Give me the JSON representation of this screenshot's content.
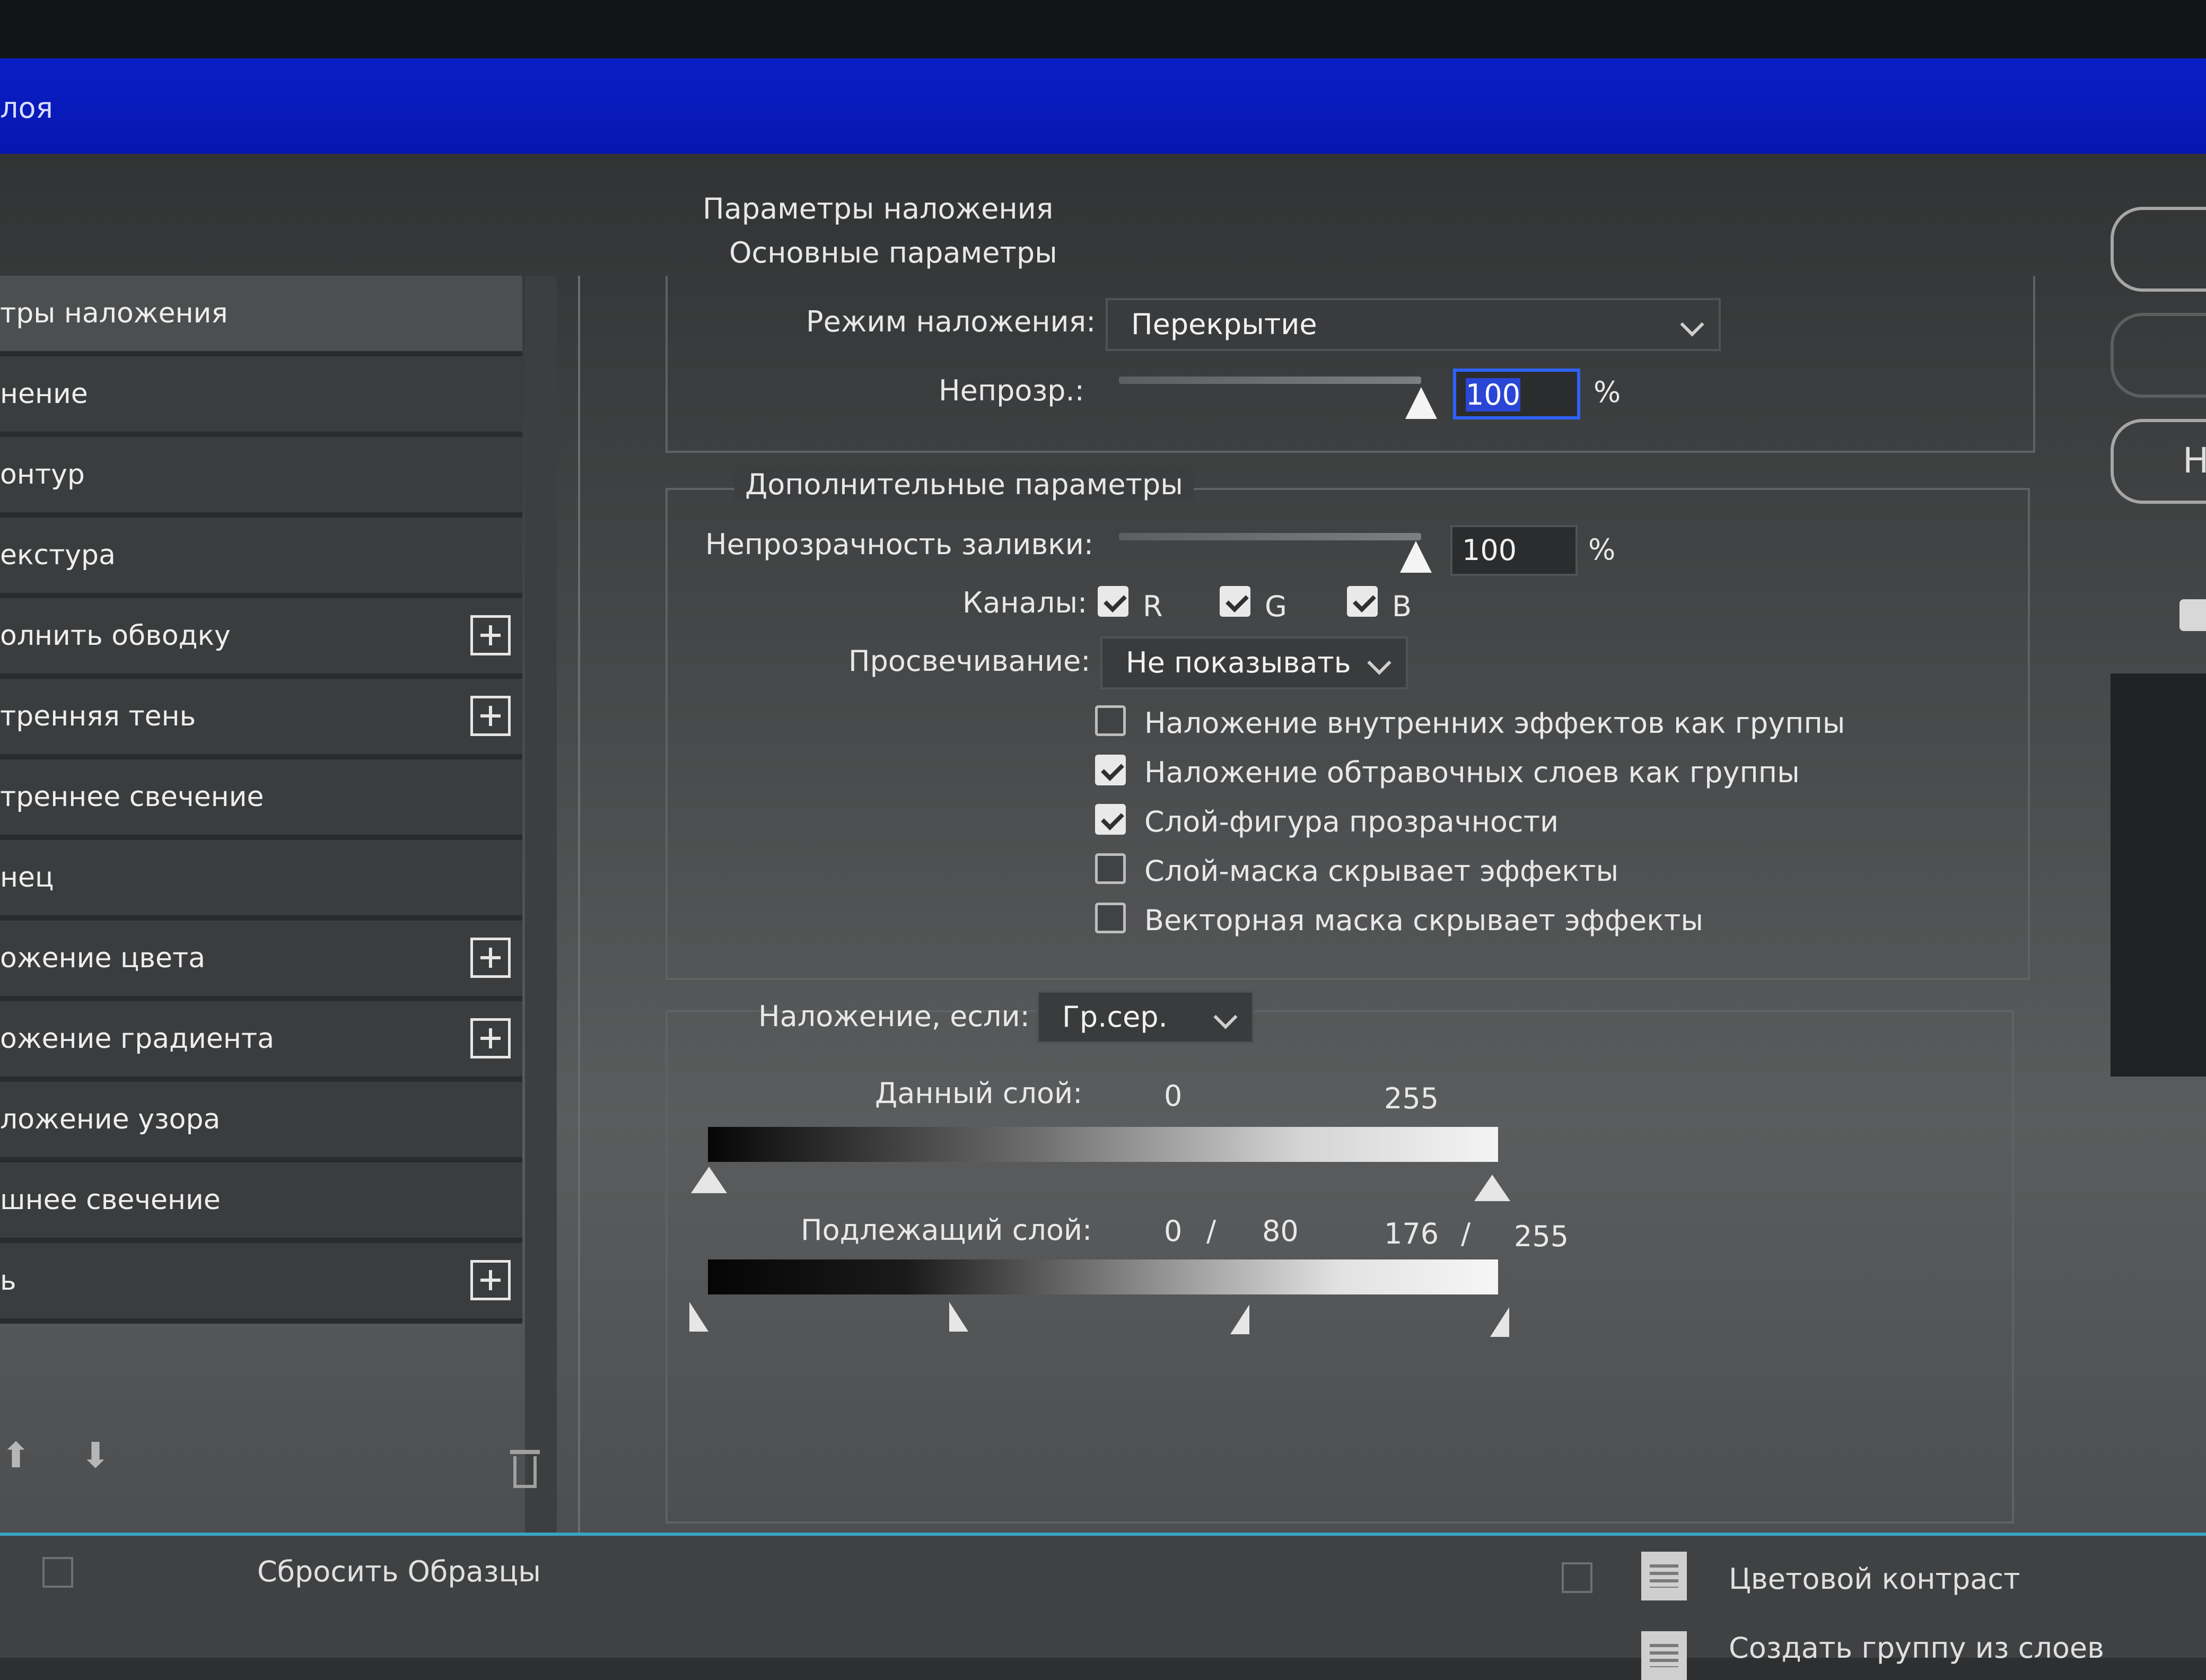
{
  "window": {
    "title_fragment": "лоя"
  },
  "left_list": {
    "items": [
      {
        "label": "тры наложения",
        "selected": true,
        "has_plus": false
      },
      {
        "label": "нение",
        "has_plus": false
      },
      {
        "label": "онтур",
        "has_plus": false
      },
      {
        "label": "екстура",
        "has_plus": false
      },
      {
        "label": "олнить обводку",
        "has_plus": true
      },
      {
        "label": "тренняя тень",
        "has_plus": true
      },
      {
        "label": "треннее свечение",
        "has_plus": false
      },
      {
        "label": "нец",
        "has_plus": false
      },
      {
        "label": "ожение цвета",
        "has_plus": true
      },
      {
        "label": "ожение градиента",
        "has_plus": true
      },
      {
        "label": "ложение узора",
        "has_plus": false
      },
      {
        "label": "шнее свечение",
        "has_plus": false
      },
      {
        "label": "ь",
        "has_plus": true
      }
    ]
  },
  "blending": {
    "section_title": "Параметры наложения",
    "basic_title": "Основные параметры",
    "mode_label": "Режим наложения:",
    "mode_value": "Перекрытие",
    "opacity_label": "Непрозр.:",
    "opacity_value": "100",
    "opacity_percent": 100,
    "percent_sign": "%"
  },
  "advanced": {
    "title": "Дополнительные параметры",
    "fill_label": "Непрозрачность заливки:",
    "fill_value": "100",
    "fill_percent": 100,
    "percent_sign": "%",
    "channels_label": "Каналы:",
    "channels": [
      {
        "label": "R",
        "checked": true
      },
      {
        "label": "G",
        "checked": true
      },
      {
        "label": "B",
        "checked": true
      }
    ],
    "knockout_label": "Просвечивание:",
    "knockout_value": "Не показывать",
    "options": [
      {
        "label": "Наложение внутренних эффектов как группы",
        "checked": false
      },
      {
        "label": "Наложение обтравочных слоев как группы",
        "checked": true
      },
      {
        "label": "Слой-фигура прозрачности",
        "checked": true
      },
      {
        "label": "Слой-маска скрывает эффекты",
        "checked": false
      },
      {
        "label": "Векторная маска скрывает эффекты",
        "checked": false
      }
    ]
  },
  "blend_if": {
    "label": "Наложение, если:",
    "value": "Гр.сер.",
    "this_layer_label": "Данный слой:",
    "this_layer_values": [
      "0",
      "255"
    ],
    "underlying_label": "Подлежащий слой:",
    "underlying_values": [
      "0",
      "/",
      "80",
      "176",
      "/",
      "255"
    ]
  },
  "bottom": {
    "reset_label": "Сбросить Образцы",
    "item1": "Цветовой контраст",
    "item2": "Создать группу из слоев"
  },
  "right_rail": {
    "button_letter": "Н"
  }
}
